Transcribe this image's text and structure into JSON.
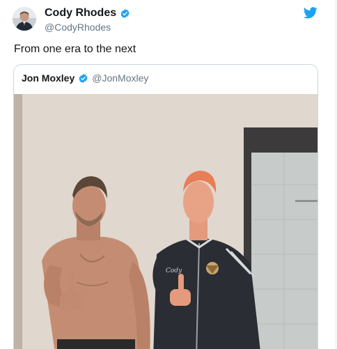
{
  "tweet": {
    "author": {
      "display_name": "Cody Rhodes",
      "handle": "@CodyRhodes"
    },
    "text": "From one era to the next",
    "icons": {
      "verified": "verified-badge-icon",
      "brand": "twitter-bird-icon"
    },
    "colors": {
      "brand": "#1da1f2",
      "text": "#14171a",
      "muted": "#657786",
      "border": "#ccd6dd"
    },
    "quoted_tweet": {
      "author": {
        "display_name": "Jon Moxley",
        "handle": "@JonMoxley"
      },
      "media": {
        "shirt_text": "Cody"
      }
    }
  }
}
